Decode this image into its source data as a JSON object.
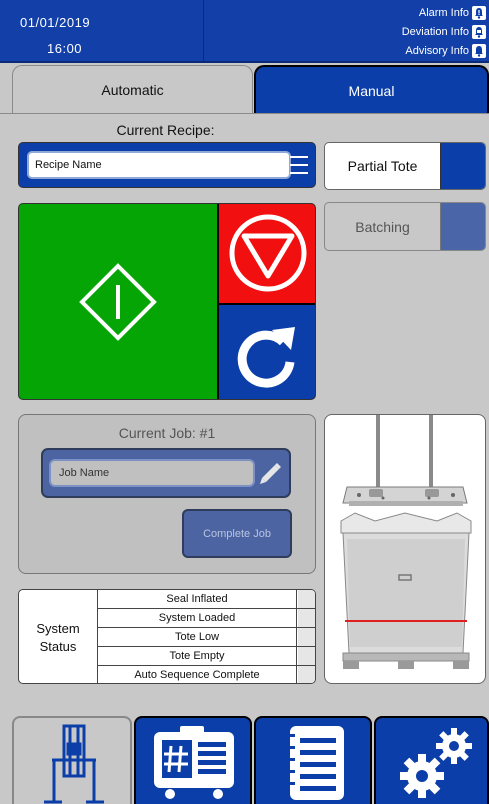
{
  "header": {
    "date": "01/01/2019",
    "time": "16:00",
    "alarm_label": "Alarm Info",
    "deviation_label": "Deviation Info",
    "advisory_label": "Advisory Info"
  },
  "tabs": {
    "automatic": "Automatic",
    "manual": "Manual"
  },
  "recipe": {
    "section_label": "Current Recipe:",
    "value": "Recipe Name"
  },
  "toggles": {
    "partial_tote": "Partial Tote",
    "batching": "Batching"
  },
  "job": {
    "title": "Current Job: #1",
    "value": "Job Name",
    "complete_label": "Complete Job"
  },
  "system_status": {
    "title_line1": "System",
    "title_line2": "Status",
    "rows": [
      "Seal Inflated",
      "System Loaded",
      "Tote Low",
      "Tote Empty",
      "Auto Sequence Complete"
    ]
  },
  "colors": {
    "primary_blue": "#0b3ea8",
    "start_green": "#06a506",
    "stop_red": "#f20f0f",
    "disabled_blue": "#4d64a3"
  },
  "icons": {
    "recipe_list": "list-icon",
    "start": "start-diamond-icon",
    "stop": "stop-triangle-icon",
    "reset": "reset-arrow-icon",
    "edit": "pencil-icon",
    "nav": [
      "station-icon",
      "id-card-icon",
      "notepad-icon",
      "gears-icon"
    ]
  }
}
